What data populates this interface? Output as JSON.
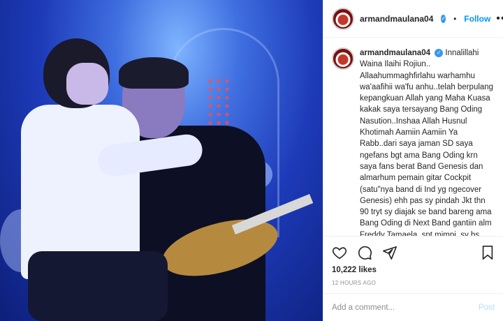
{
  "post": {
    "username": "armandmaulana04",
    "follow_label": "Follow",
    "more_label": "•••",
    "caption_username": "armandmaulana04",
    "caption": "Innalillahi Waina Ilaihi Rojiun.. Allaahummaghfirlahu warhamhu wa'aafihii wa'fu anhu..telah berpulang kepangkuan Allah yang Maha Kuasa kakak saya tersayang Bang Oding Nasution..Inshaa Allah Husnul Khotimah Aamiin Aamiin Ya Rabb..dari saya jaman SD saya ngefans bgt ama Bang Oding krn saya fans berat Band Genesis dan almarhum pemain gitar Cockpit (satu\"nya band di Ind yg ngecover Genesis) ehh pas sy pindah Jkt thn 90 tryt sy diajak se band bareng ama Bang Oding di Next Band gantiin alm Freddy Tamaela..spt mimpi..sy bs seband dgn almarhum..kesan sy terhadap Bang Oding selama ini orangnya udah pasti baik...baik banget...",
    "likes": "10,222 likes",
    "timestamp": "12 HOURS AGO",
    "comment_placeholder": "Add a comment...",
    "post_button": "Post",
    "colors": {
      "accent": "#0095f6",
      "verified": "#3897f0",
      "muted": "#8e8e8e"
    },
    "icons": [
      "heart-icon",
      "comment-icon",
      "share-icon",
      "bookmark-icon",
      "verified-icon"
    ]
  }
}
